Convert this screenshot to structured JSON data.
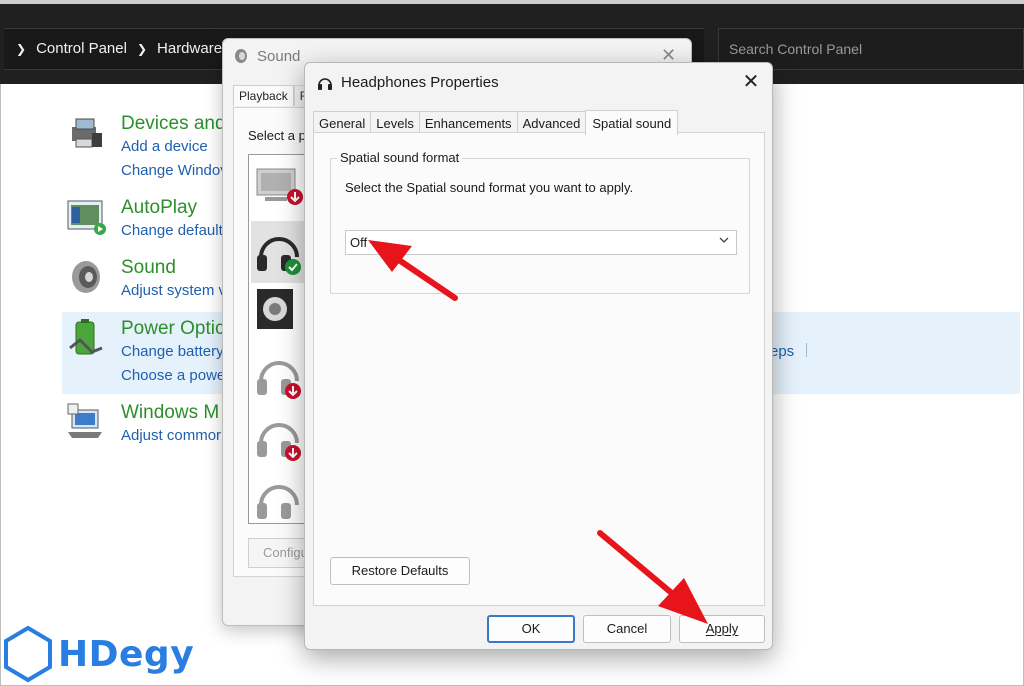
{
  "address_bar": {
    "breadcrumbs": [
      "Control Panel",
      "Hardware an"
    ],
    "search_placeholder": "Search Control Panel"
  },
  "control_panel": {
    "items": [
      {
        "title": "Devices and",
        "icon": "devices-printers-icon",
        "links": [
          "Add a device",
          "Change Windov"
        ]
      },
      {
        "title": "AutoPlay",
        "icon": "autoplay-icon",
        "links": [
          "Change default"
        ]
      },
      {
        "title": "Sound",
        "icon": "speaker-icon",
        "links": [
          "Adjust system v"
        ]
      },
      {
        "title": "Power Optic",
        "icon": "battery-plug-icon",
        "links": [
          "Change battery",
          "Choose a powe"
        ]
      },
      {
        "title": "Windows M",
        "icon": "mobility-center-icon",
        "links": [
          "Adjust commor"
        ]
      }
    ],
    "power_extra_link": "eps"
  },
  "sound_dialog": {
    "title": "Sound",
    "tabs": [
      "Playback",
      "R"
    ],
    "select_prompt": "Select a p",
    "configure_label": "Configu"
  },
  "headphones_dialog": {
    "title": "Headphones Properties",
    "tabs": [
      "General",
      "Levels",
      "Enhancements",
      "Advanced",
      "Spatial sound"
    ],
    "active_tab": "Spatial sound",
    "group_label": "Spatial sound format",
    "group_description": "Select the Spatial sound format you want to apply.",
    "format_value": "Off",
    "restore_label": "Restore Defaults",
    "ok_label": "OK",
    "cancel_label": "Cancel",
    "apply_label": "Apply"
  },
  "watermark": {
    "text": "HDegy"
  },
  "colors": {
    "annotation_red": "#e8141c",
    "link_blue": "#1f5fb0",
    "title_green": "#2c8f2c",
    "logo_blue": "#2a7de1"
  }
}
